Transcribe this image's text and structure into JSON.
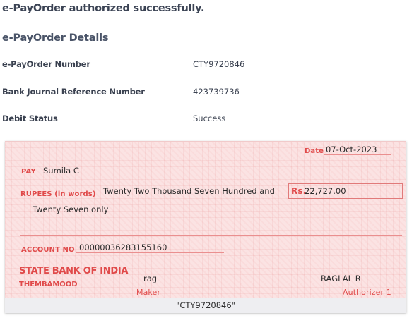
{
  "status_message": "e-PayOrder authorized successfully.",
  "details": {
    "title": "e-PayOrder Details",
    "rows": [
      {
        "label": "e-PayOrder Number",
        "value": "CTY9720846"
      },
      {
        "label": "Bank Journal Reference Number",
        "value": "423739736"
      },
      {
        "label": "Debit Status",
        "value": "Success"
      }
    ]
  },
  "cheque": {
    "date_label": "Date",
    "date_value": "07-Oct-2023",
    "pay_label": "PAY",
    "payee": "Sumila C",
    "rupees_label": "RUPEES (in words)",
    "amount_words_line1": "Twenty Two Thousand Seven Hundred and",
    "amount_words_line2": "Twenty Seven only",
    "rs_label": "Rs.",
    "amount": "22,727.00",
    "account_label": "ACCOUNT NO",
    "account_number": "00000036283155160",
    "bank_name": "STATE BANK OF INDIA",
    "branch": "THEMBAMOOD",
    "maker_name": "rag",
    "maker_label": "Maker",
    "authorizer_name": "RAGLAL R",
    "authorizer_label": "Authorizer 1",
    "micr": "\"CTY9720846\""
  },
  "colors": {
    "cheque_accent": "#e04a4a",
    "cheque_background": "#fbe3e3",
    "text": "#3a4150"
  }
}
